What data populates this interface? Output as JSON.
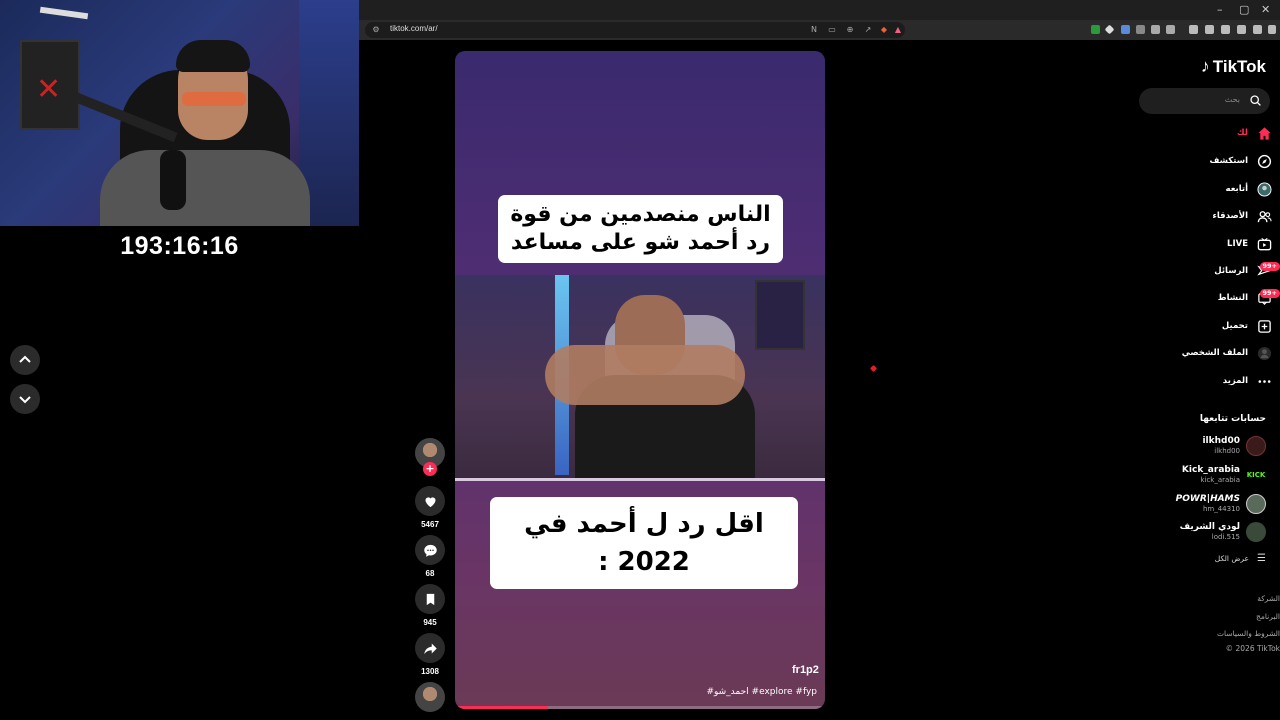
{
  "stream": {
    "timer": "193:16:16"
  },
  "browser": {
    "url": "tiktok.com/ar/",
    "window_controls": [
      "–",
      "▢",
      "✕"
    ]
  },
  "video": {
    "caption_top": "الناس منصدمين من قوة رد أحمد شو على مساعد",
    "caption_bottom": "اقل رد ل أحمد في 2022 :",
    "author": "fr1p2",
    "tags": "#احمد_شو #explore #fyp",
    "progress": 0.25
  },
  "actions": {
    "plus": "+",
    "likes": "5467",
    "comments": "68",
    "saves": "945",
    "shares": "1308"
  },
  "sidebar": {
    "logo": "TikTok",
    "search_placeholder": "بحث",
    "menu": [
      {
        "label": "لك",
        "icon": "home-icon",
        "active": true
      },
      {
        "label": "استكشف",
        "icon": "compass-icon"
      },
      {
        "label": "أتابعه",
        "icon": "following-avatar-icon"
      },
      {
        "label": "الأصدقاء",
        "icon": "friends-icon"
      },
      {
        "label": "LIVE",
        "icon": "live-icon"
      },
      {
        "label": "الرسائل",
        "icon": "messages-icon",
        "badge": "99+"
      },
      {
        "label": "النشاط",
        "icon": "activity-icon",
        "badge": "99+"
      },
      {
        "label": "تحميل",
        "icon": "upload-icon"
      },
      {
        "label": "الملف الشخصي",
        "icon": "profile-icon"
      },
      {
        "label": "المزيد",
        "icon": "more-icon"
      }
    ],
    "following_title": "حسابات تتابعها",
    "following": [
      {
        "name": "ilkhd00",
        "handle": "ilkhd00",
        "color": "#3a1a1a"
      },
      {
        "name": "Kick_arabia",
        "handle": "kick_arabia",
        "color": "#53fc18"
      },
      {
        "name": "POWR|HAMS",
        "handle": "hm_44310",
        "color": "#5a6a5a"
      },
      {
        "name": "لودي الشريف",
        "handle": "lodi.515",
        "color": "#3a4a3a"
      }
    ],
    "see_all": "عرض الكل",
    "footer": [
      "الشركة",
      "البرنامج",
      "الشروط والسياسات",
      "© 2026 TikTok"
    ]
  }
}
